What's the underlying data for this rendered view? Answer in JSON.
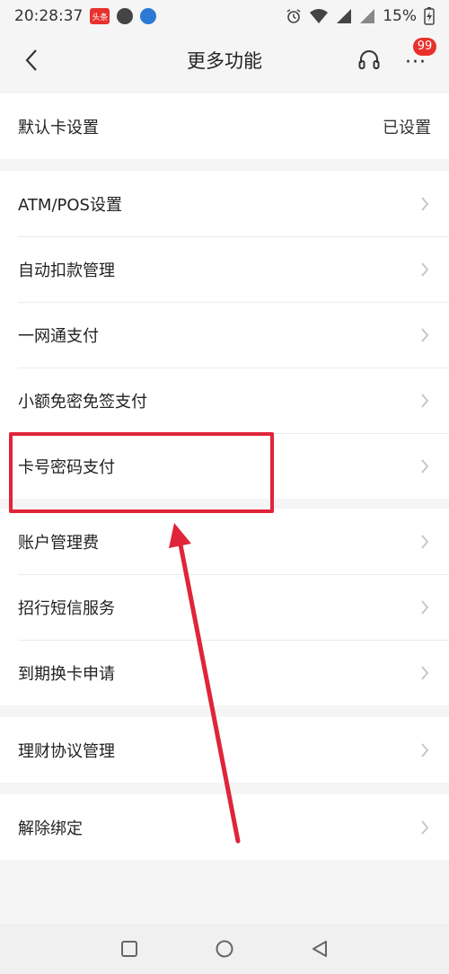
{
  "status_bar": {
    "time": "20:28:37",
    "app_icon_label": "头条",
    "battery": "15%"
  },
  "header": {
    "title": "更多功能",
    "badge_count": "99"
  },
  "sections": [
    {
      "items": [
        {
          "label": "默认卡设置",
          "value": "已设置"
        }
      ]
    },
    {
      "items": [
        {
          "label": "ATM/POS设置"
        },
        {
          "label": "自动扣款管理"
        },
        {
          "label": "一网通支付"
        },
        {
          "label": "小额免密免签支付"
        },
        {
          "label": "卡号密码支付"
        }
      ]
    },
    {
      "items": [
        {
          "label": "账户管理费"
        },
        {
          "label": "招行短信服务"
        },
        {
          "label": "到期换卡申请"
        }
      ]
    },
    {
      "items": [
        {
          "label": "理财协议管理"
        }
      ]
    },
    {
      "items": [
        {
          "label": "解除绑定"
        }
      ]
    }
  ],
  "colors": {
    "highlight": "#e0243a",
    "badge": "#e8312c"
  }
}
